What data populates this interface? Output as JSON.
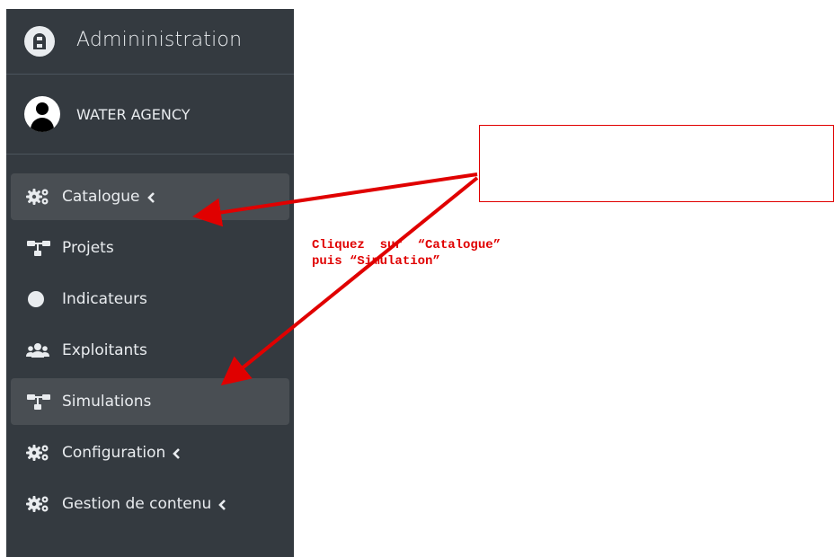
{
  "brand": {
    "title": "Admininistration",
    "logo_icon": "brand-logo-icon"
  },
  "user": {
    "name": "WATER AGENCY",
    "avatar_icon": "user-avatar-icon"
  },
  "nav": {
    "items": [
      {
        "label": "Catalogue",
        "icon": "gears-icon",
        "has_chevron": true,
        "active": true
      },
      {
        "label": "Projets",
        "icon": "sitemap-icon",
        "has_chevron": false,
        "active": false
      },
      {
        "label": "Indicateurs",
        "icon": "circle-icon",
        "has_chevron": false,
        "active": false
      },
      {
        "label": "Exploitants",
        "icon": "users-icon",
        "has_chevron": false,
        "active": false
      },
      {
        "label": "Simulations",
        "icon": "sitemap-icon",
        "has_chevron": false,
        "active": true
      },
      {
        "label": "Configuration",
        "icon": "gears-icon",
        "has_chevron": true,
        "active": false
      },
      {
        "label": "Gestion de contenu",
        "icon": "gears-icon",
        "has_chevron": true,
        "active": false
      }
    ]
  },
  "annotation": {
    "line1": "Cliquez  sur  “Catalogue”",
    "line2": "puis “Simulation”",
    "color": "#e00000"
  },
  "colors": {
    "sidebar_bg": "#343a40",
    "active_bg": "#494e53",
    "text": "#e9ecef"
  }
}
